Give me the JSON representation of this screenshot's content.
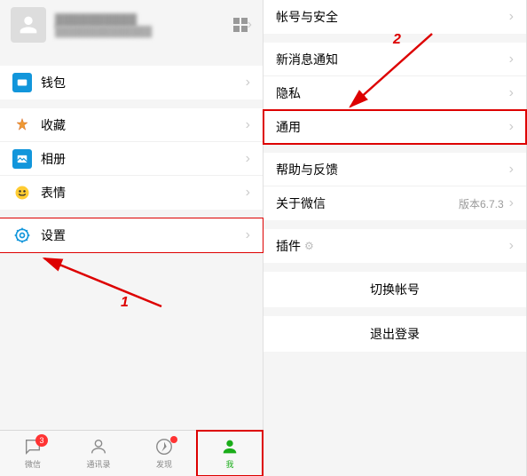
{
  "profile": {
    "name": "██████████",
    "id": "██████████████",
    "qr_label": ">"
  },
  "left": {
    "wallet": "钱包",
    "favorites": "收藏",
    "album": "相册",
    "sticker": "表情",
    "settings": "设置"
  },
  "right": {
    "account_security": "帐号与安全",
    "notifications": "新消息通知",
    "privacy": "隐私",
    "general": "通用",
    "help_feedback": "帮助与反馈",
    "about": "关于微信",
    "about_version": "版本6.7.3",
    "plugin": "插件",
    "switch_account": "切换帐号",
    "logout": "退出登录"
  },
  "tabs": {
    "chats": "微信",
    "contacts": "通讯录",
    "discover": "发现",
    "me": "我",
    "chats_badge": "3"
  },
  "annotations": {
    "step1": "1",
    "step2": "2"
  }
}
